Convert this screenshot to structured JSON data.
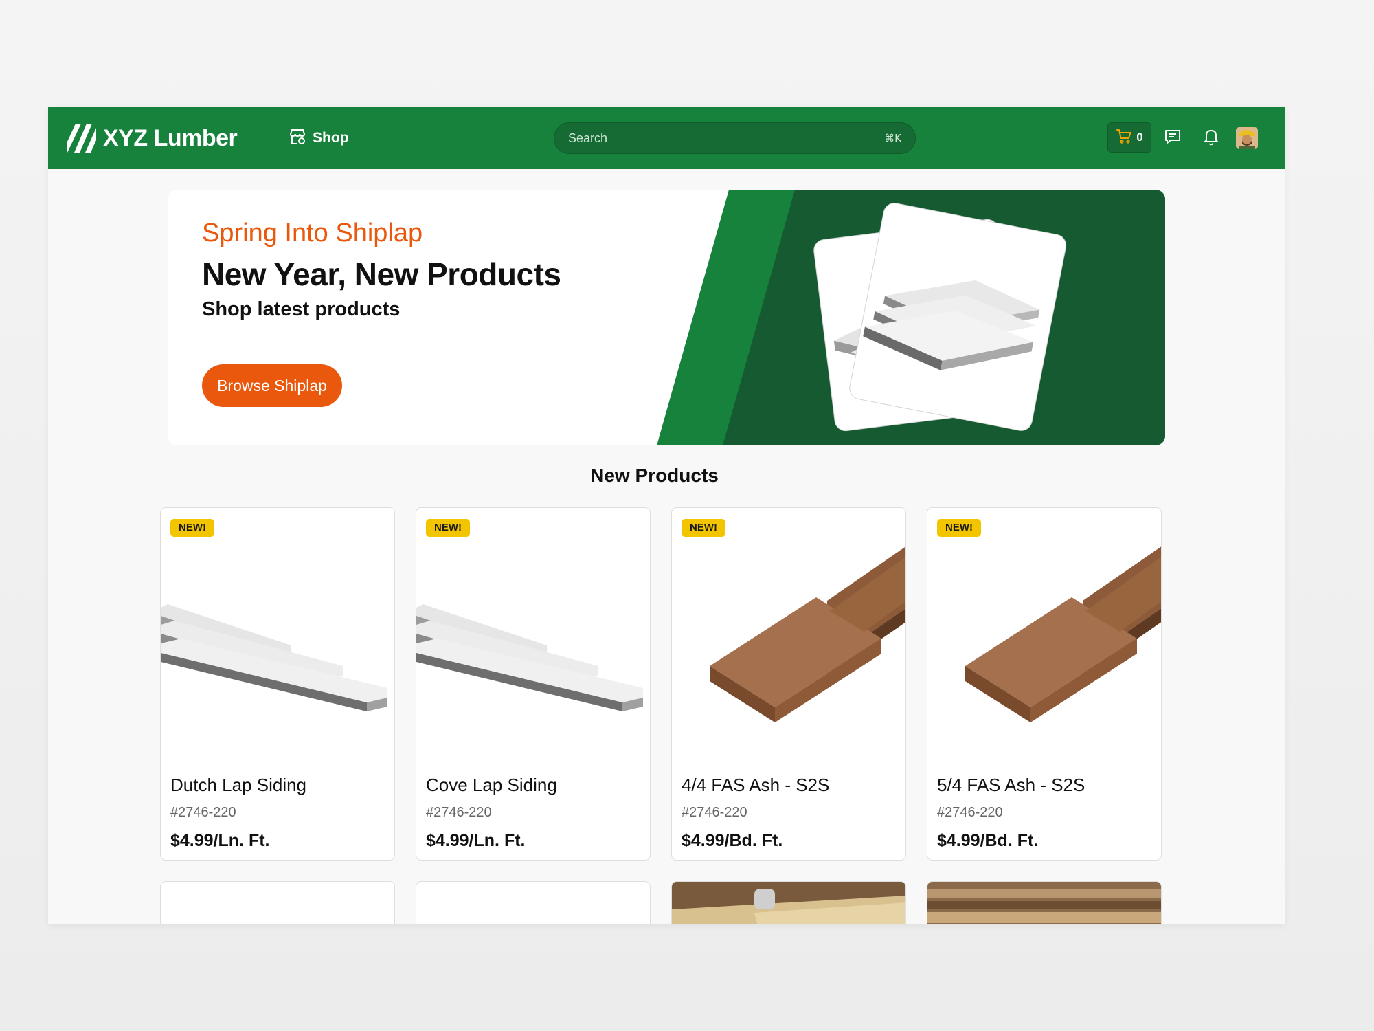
{
  "header": {
    "brand": "XYZ Lumber",
    "shop_label": "Shop",
    "search_placeholder": "Search",
    "search_shortcut": "⌘K",
    "cart_count": "0"
  },
  "hero": {
    "eyebrow": "Spring Into Shiplap",
    "title": "New Year, New Products",
    "subtitle": "Shop latest products",
    "cta_label": "Browse Shiplap"
  },
  "section_title": "New Products",
  "products": [
    {
      "badge": "NEW!",
      "name": "Dutch Lap Siding",
      "sku": "#2746-220",
      "price": "$4.99/Ln. Ft.",
      "image": "shiplap-white"
    },
    {
      "badge": "NEW!",
      "name": "Cove Lap Siding",
      "sku": "#2746-220",
      "price": "$4.99/Ln. Ft.",
      "image": "shiplap-white"
    },
    {
      "badge": "NEW!",
      "name": "4/4 FAS Ash - S2S",
      "sku": "#2746-220",
      "price": "$4.99/Bd. Ft.",
      "image": "ash-board"
    },
    {
      "badge": "NEW!",
      "name": "5/4 FAS Ash - S2S",
      "sku": "#2746-220",
      "price": "$4.99/Bd. Ft.",
      "image": "ash-board"
    }
  ],
  "colors": {
    "brand_green": "#17823c",
    "dark_green": "#155a30",
    "accent_orange": "#e9580c",
    "badge_yellow": "#f3c400"
  }
}
